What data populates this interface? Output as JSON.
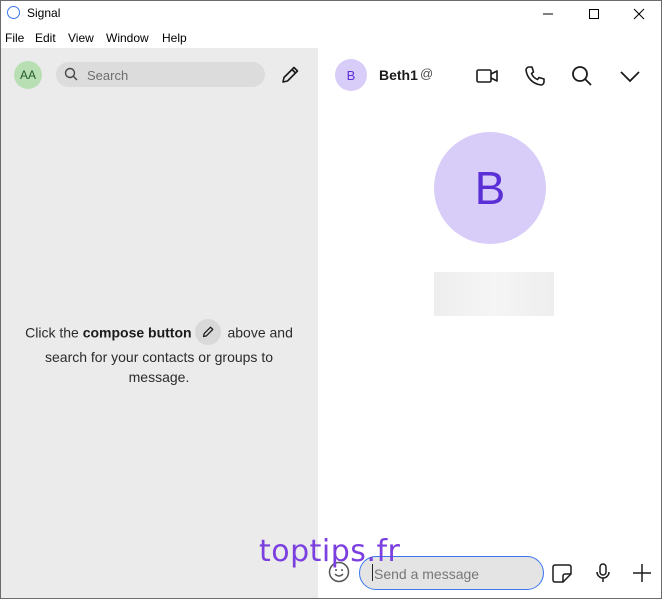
{
  "window": {
    "title": "Signal",
    "accent": "#3a76f0"
  },
  "menu": [
    "File",
    "Edit",
    "View",
    "Window",
    "Help"
  ],
  "left": {
    "avatar_initials": "AA",
    "search_placeholder": "Search",
    "empty_before": "Click the ",
    "empty_bold": "compose button",
    "empty_after": " above and search for your contacts or groups to message."
  },
  "conversation": {
    "avatar_letter": "B",
    "contact_name": "Beth1",
    "composer_placeholder": "Send a message"
  },
  "watermark": "toptips.fr",
  "icons": {
    "header": [
      "video-icon",
      "phone-icon",
      "search-icon",
      "chevron-down-icon"
    ],
    "footer": [
      "emoji-icon",
      "sticker-icon",
      "microphone-icon",
      "plus-icon"
    ]
  }
}
